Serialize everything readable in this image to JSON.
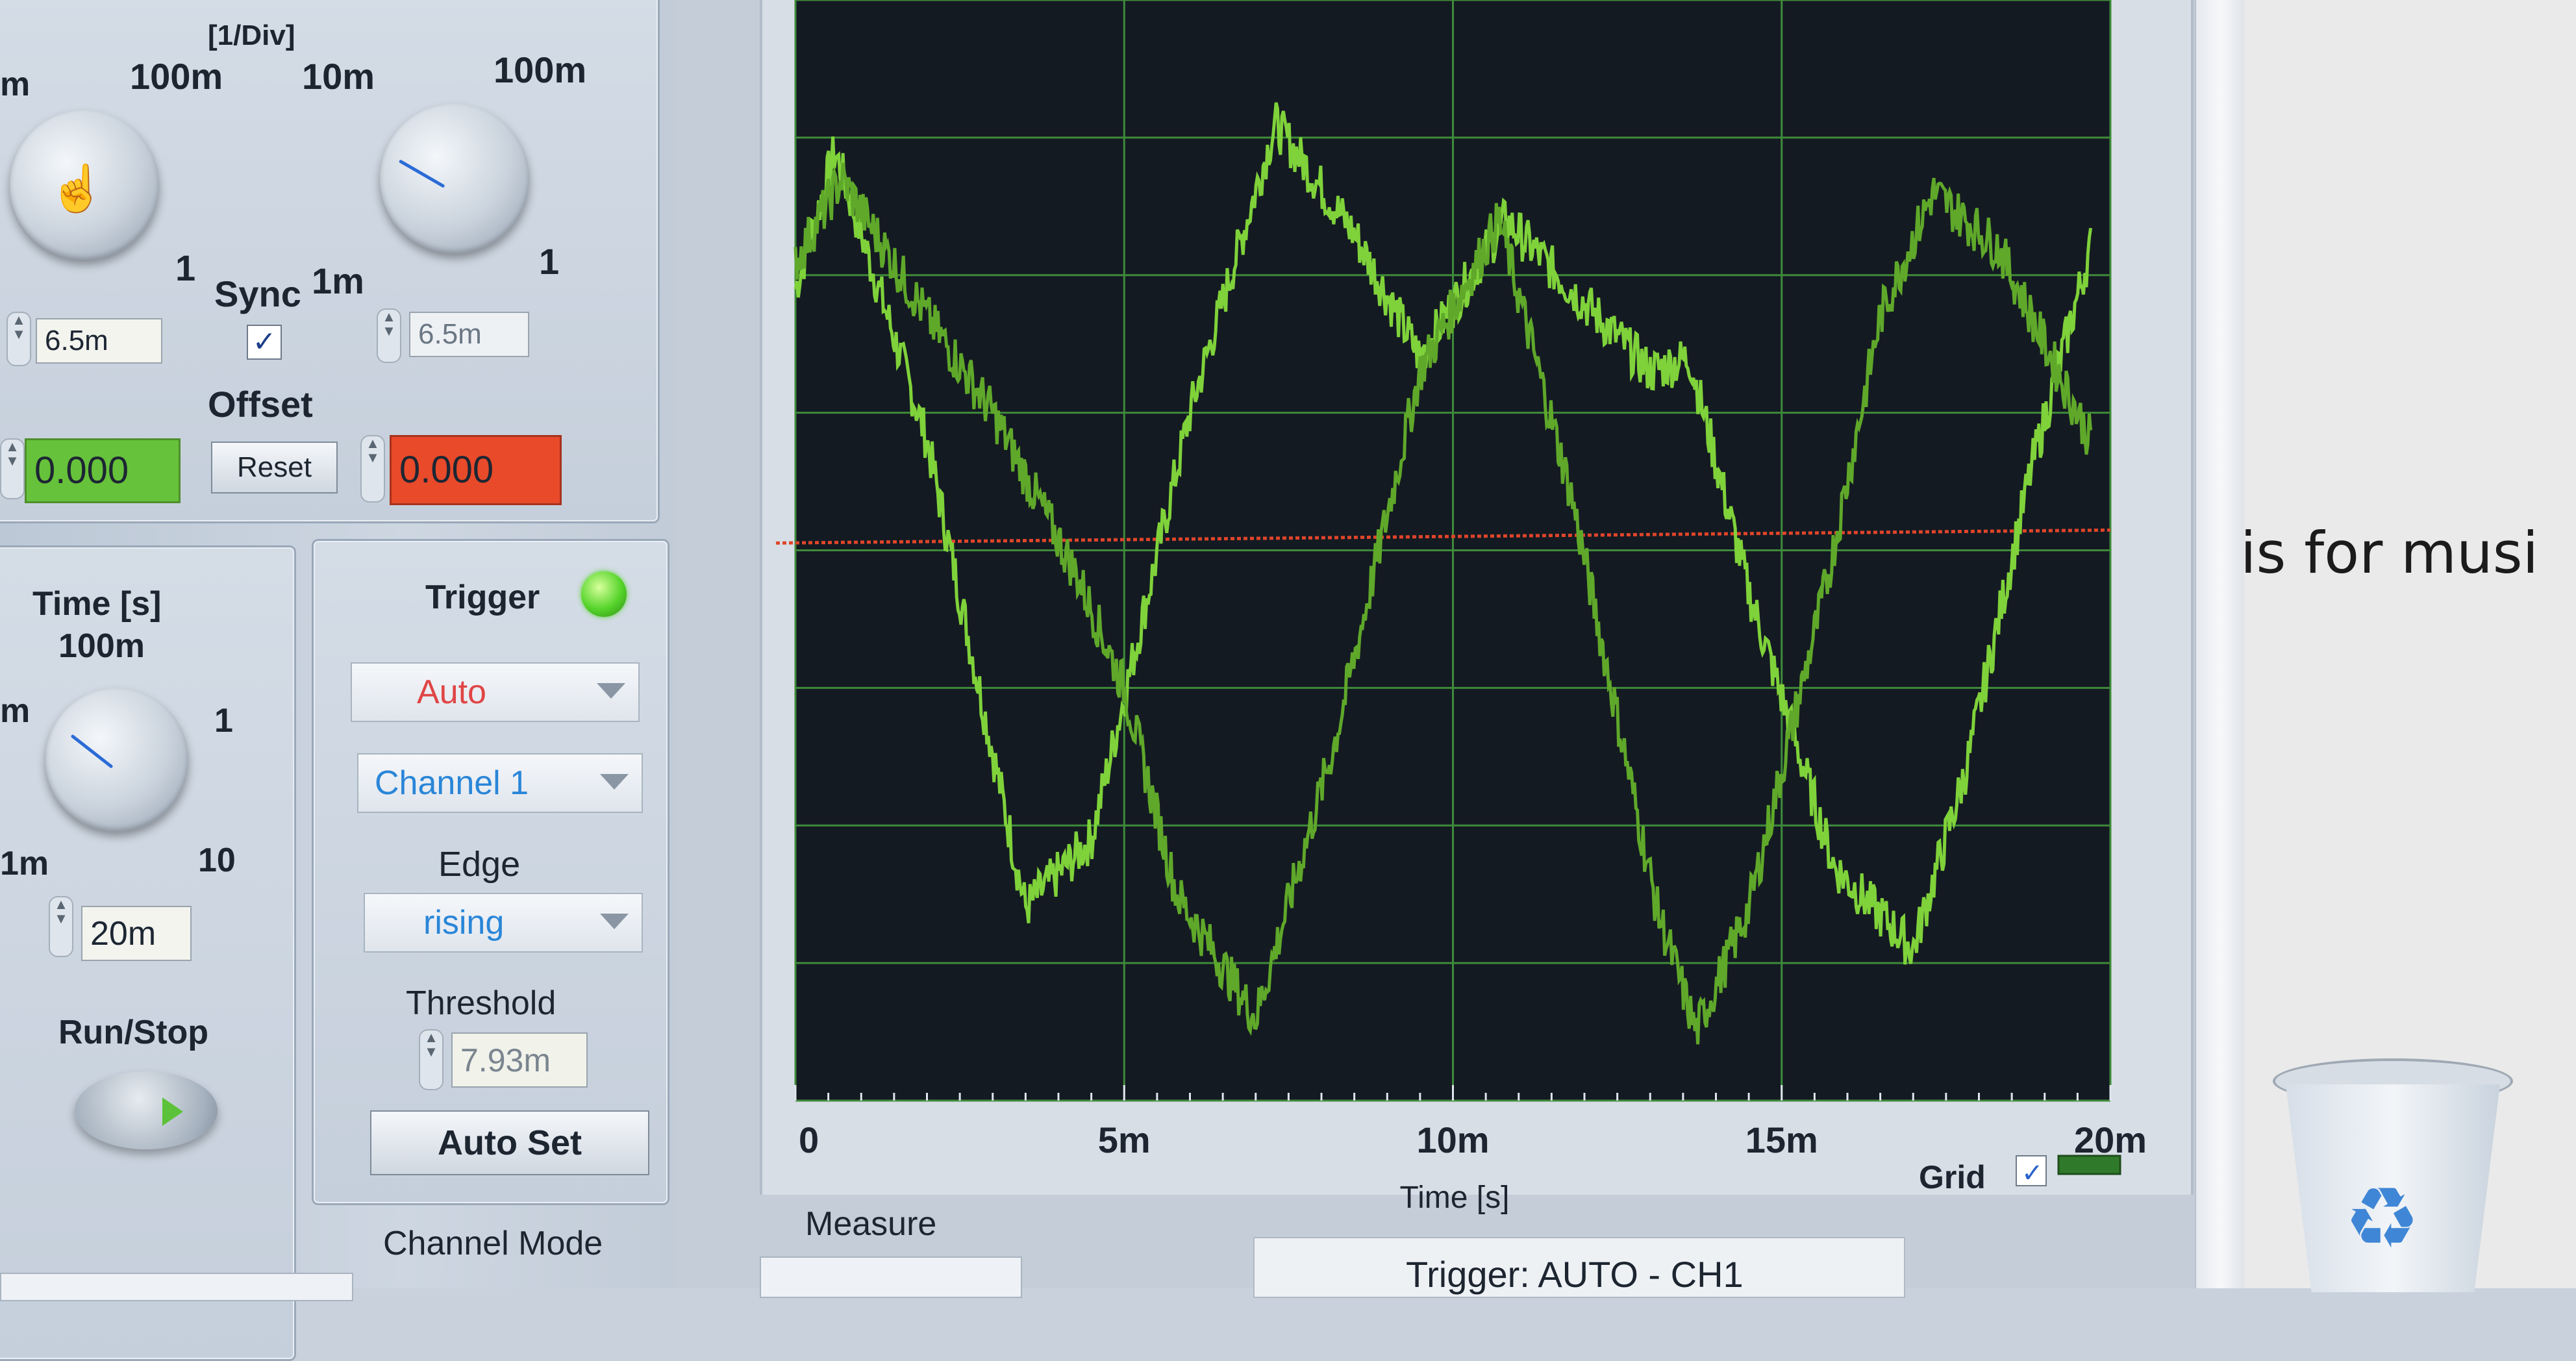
{
  "amplitude": {
    "header": "[1/Div]",
    "knob1": {
      "left_label": "m",
      "top_label": "100m",
      "right_label": "1",
      "bottom_label": "",
      "value": "6.5m"
    },
    "knob2": {
      "top_left_label": "10m",
      "top_right_label": "100m",
      "left_label": "1m",
      "right_label": "1",
      "value": "6.5m"
    },
    "sync_label": "Sync",
    "sync_checked": true,
    "offset_label": "Offset",
    "reset_label": "Reset",
    "offset_ch1": "0.000",
    "offset_ch2": "0.000"
  },
  "time": {
    "title": "Time [s]",
    "top_label": "100m",
    "left_label": "m",
    "right_label": "1",
    "bottom_left_label": "1m",
    "bottom_right_label": "10",
    "value": "20m"
  },
  "run_stop_label": "Run/Stop",
  "trigger": {
    "title": "Trigger",
    "mode": "Auto",
    "source": "Channel 1",
    "edge_label": "Edge",
    "edge": "rising",
    "threshold_label": "Threshold",
    "threshold": "7.93m",
    "auto_set_label": "Auto Set"
  },
  "channel_mode_label": "Channel Mode",
  "measure_label": "Measure",
  "status_text": "Trigger: AUTO - CH1",
  "graph": {
    "x_ticks": [
      "0",
      "5m",
      "10m",
      "15m",
      "20m"
    ],
    "x_label": "Time [s]",
    "grid_label": "Grid",
    "grid_checked": true
  },
  "doc_text": "is for musi",
  "colors": {
    "trace": "#7fd23a",
    "trace_dim": "#5fa82a",
    "trigger_line": "#e0452a",
    "offset_ch1_bg": "#66c23a",
    "offset_ch2_bg": "#e84a2a",
    "led": "#55d42a"
  },
  "chart_data": {
    "type": "line",
    "xlim": [
      0,
      0.02
    ],
    "ylim": [
      -4,
      4
    ],
    "xlabel": "Time [s]",
    "ylabel": "",
    "x_tick_labels": [
      "0",
      "5m",
      "10m",
      "15m",
      "20m"
    ],
    "grid": true,
    "series": [
      {
        "x": [
          0,
          0.0006,
          0.002,
          0.0035,
          0.0045,
          0.006,
          0.0073,
          0.0085,
          0.0095,
          0.0108,
          0.012,
          0.013,
          0.0136,
          0.0145,
          0.0158,
          0.017,
          0.0178,
          0.0188,
          0.0197
        ],
        "y": [
          1.9,
          2.9,
          0.8,
          -2.6,
          -2.1,
          1.0,
          3.1,
          2.3,
          1.4,
          2.4,
          1.8,
          1.3,
          1.4,
          -0.3,
          -2.3,
          -2.9,
          -1.6,
          0.6,
          2.2
        ]
      },
      {
        "x": [
          0,
          0.0007,
          0.002,
          0.003,
          0.0043,
          0.005,
          0.0058,
          0.007,
          0.0082,
          0.0095,
          0.0107,
          0.0118,
          0.0131,
          0.0137,
          0.0145,
          0.0157,
          0.0165,
          0.0173,
          0.0183,
          0.0197
        ],
        "y": [
          2.1,
          2.7,
          1.7,
          1.0,
          -0.2,
          -1.0,
          -2.5,
          -3.4,
          -1.4,
          1.3,
          2.4,
          0.4,
          -2.6,
          -3.5,
          -2.6,
          -0.2,
          1.7,
          2.6,
          2.2,
          0.8
        ]
      }
    ],
    "trigger_level": 0.1
  }
}
